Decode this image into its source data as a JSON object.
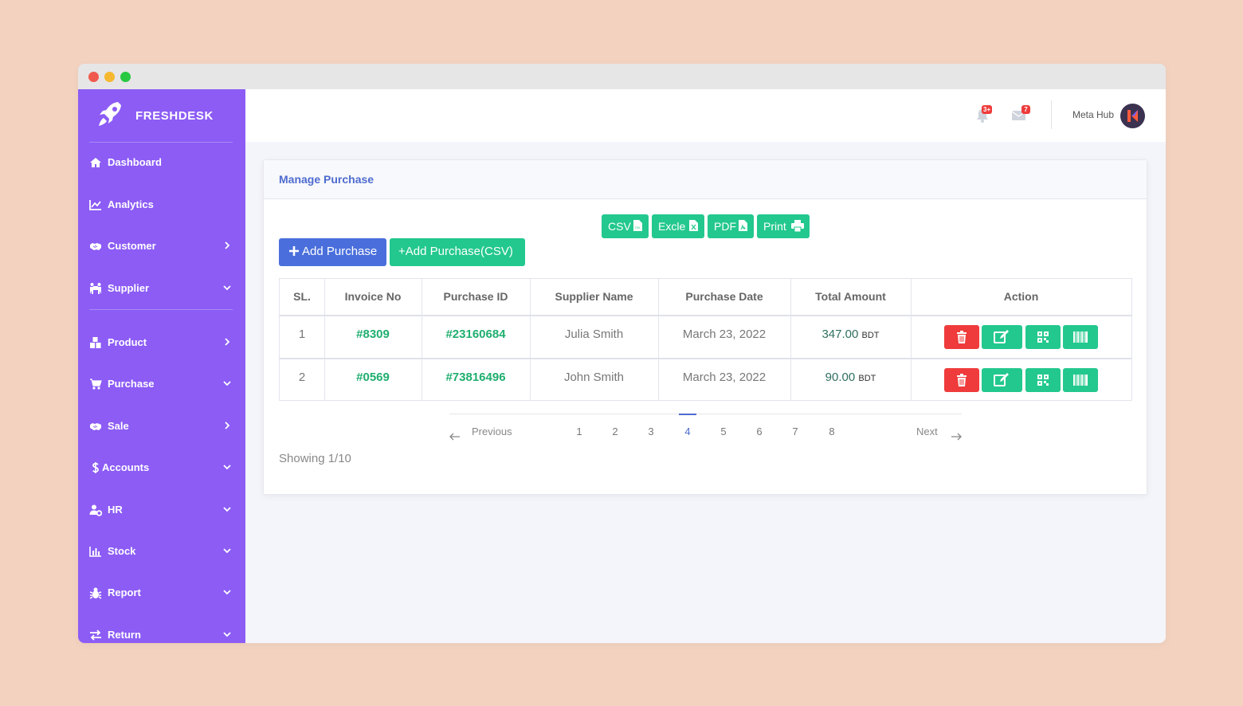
{
  "app": {
    "brand": "FRESHDESK"
  },
  "sidebar": {
    "items": [
      {
        "label": "Dashboard",
        "icon": "home-icon"
      },
      {
        "label": "Analytics",
        "icon": "chart-line-icon"
      },
      {
        "label": "Customer",
        "icon": "handshake-icon",
        "chevron": "right"
      },
      {
        "label": "Supplier",
        "icon": "people-carry-icon",
        "chevron": "down"
      },
      {
        "label": "Product",
        "icon": "boxes-icon",
        "chevron": "right"
      },
      {
        "label": "Purchase",
        "icon": "cart-icon",
        "chevron": "down"
      },
      {
        "label": "Sale",
        "icon": "handshake-icon",
        "chevron": "right"
      },
      {
        "label": "Accounts",
        "icon": "dollar-icon",
        "chevron": "down"
      },
      {
        "label": "HR",
        "icon": "user-gear-icon",
        "chevron": "down"
      },
      {
        "label": "Stock",
        "icon": "bar-chart-icon",
        "chevron": "down"
      },
      {
        "label": "Report",
        "icon": "bug-icon",
        "chevron": "down"
      },
      {
        "label": "Return",
        "icon": "exchange-icon",
        "chevron": "down"
      }
    ]
  },
  "topbar": {
    "notifications_badge": "3+",
    "messages_badge": "7",
    "user_name": "Meta Hub"
  },
  "card": {
    "title": "Manage Purchase",
    "export_buttons": [
      "CSV",
      "Excle",
      "PDF",
      "Print"
    ],
    "add_button": "Add Purchase",
    "add_csv_button": "+Add Purchase(CSV)"
  },
  "table": {
    "headers": [
      "SL.",
      "Invoice No",
      "Purchase ID",
      "Supplier Name",
      "Purchase Date",
      "Total Amount",
      "Action"
    ],
    "rows": [
      {
        "sl": "1",
        "invoice": "#8309",
        "purchase_id": "#23160684",
        "supplier": "Julia Smith",
        "date": "March 23, 2022",
        "amount": "347.00",
        "currency": "BDT"
      },
      {
        "sl": "2",
        "invoice": "#0569",
        "purchase_id": "#73816496",
        "supplier": "John Smith",
        "date": "March 23, 2022",
        "amount": "90.00",
        "currency": "BDT"
      }
    ]
  },
  "pagination": {
    "previous": "Previous",
    "next": "Next",
    "pages": [
      "1",
      "2",
      "3",
      "4",
      "5",
      "6",
      "7",
      "8"
    ],
    "active": "4"
  },
  "footer": {
    "showing": "Showing 1/10"
  },
  "colors": {
    "sidebar": "#8c5cf5",
    "primary_blue": "#4a6fdc",
    "accent_green": "#23c88e",
    "danger_red": "#ef3b3b",
    "title_blue": "#4e6bcf"
  }
}
